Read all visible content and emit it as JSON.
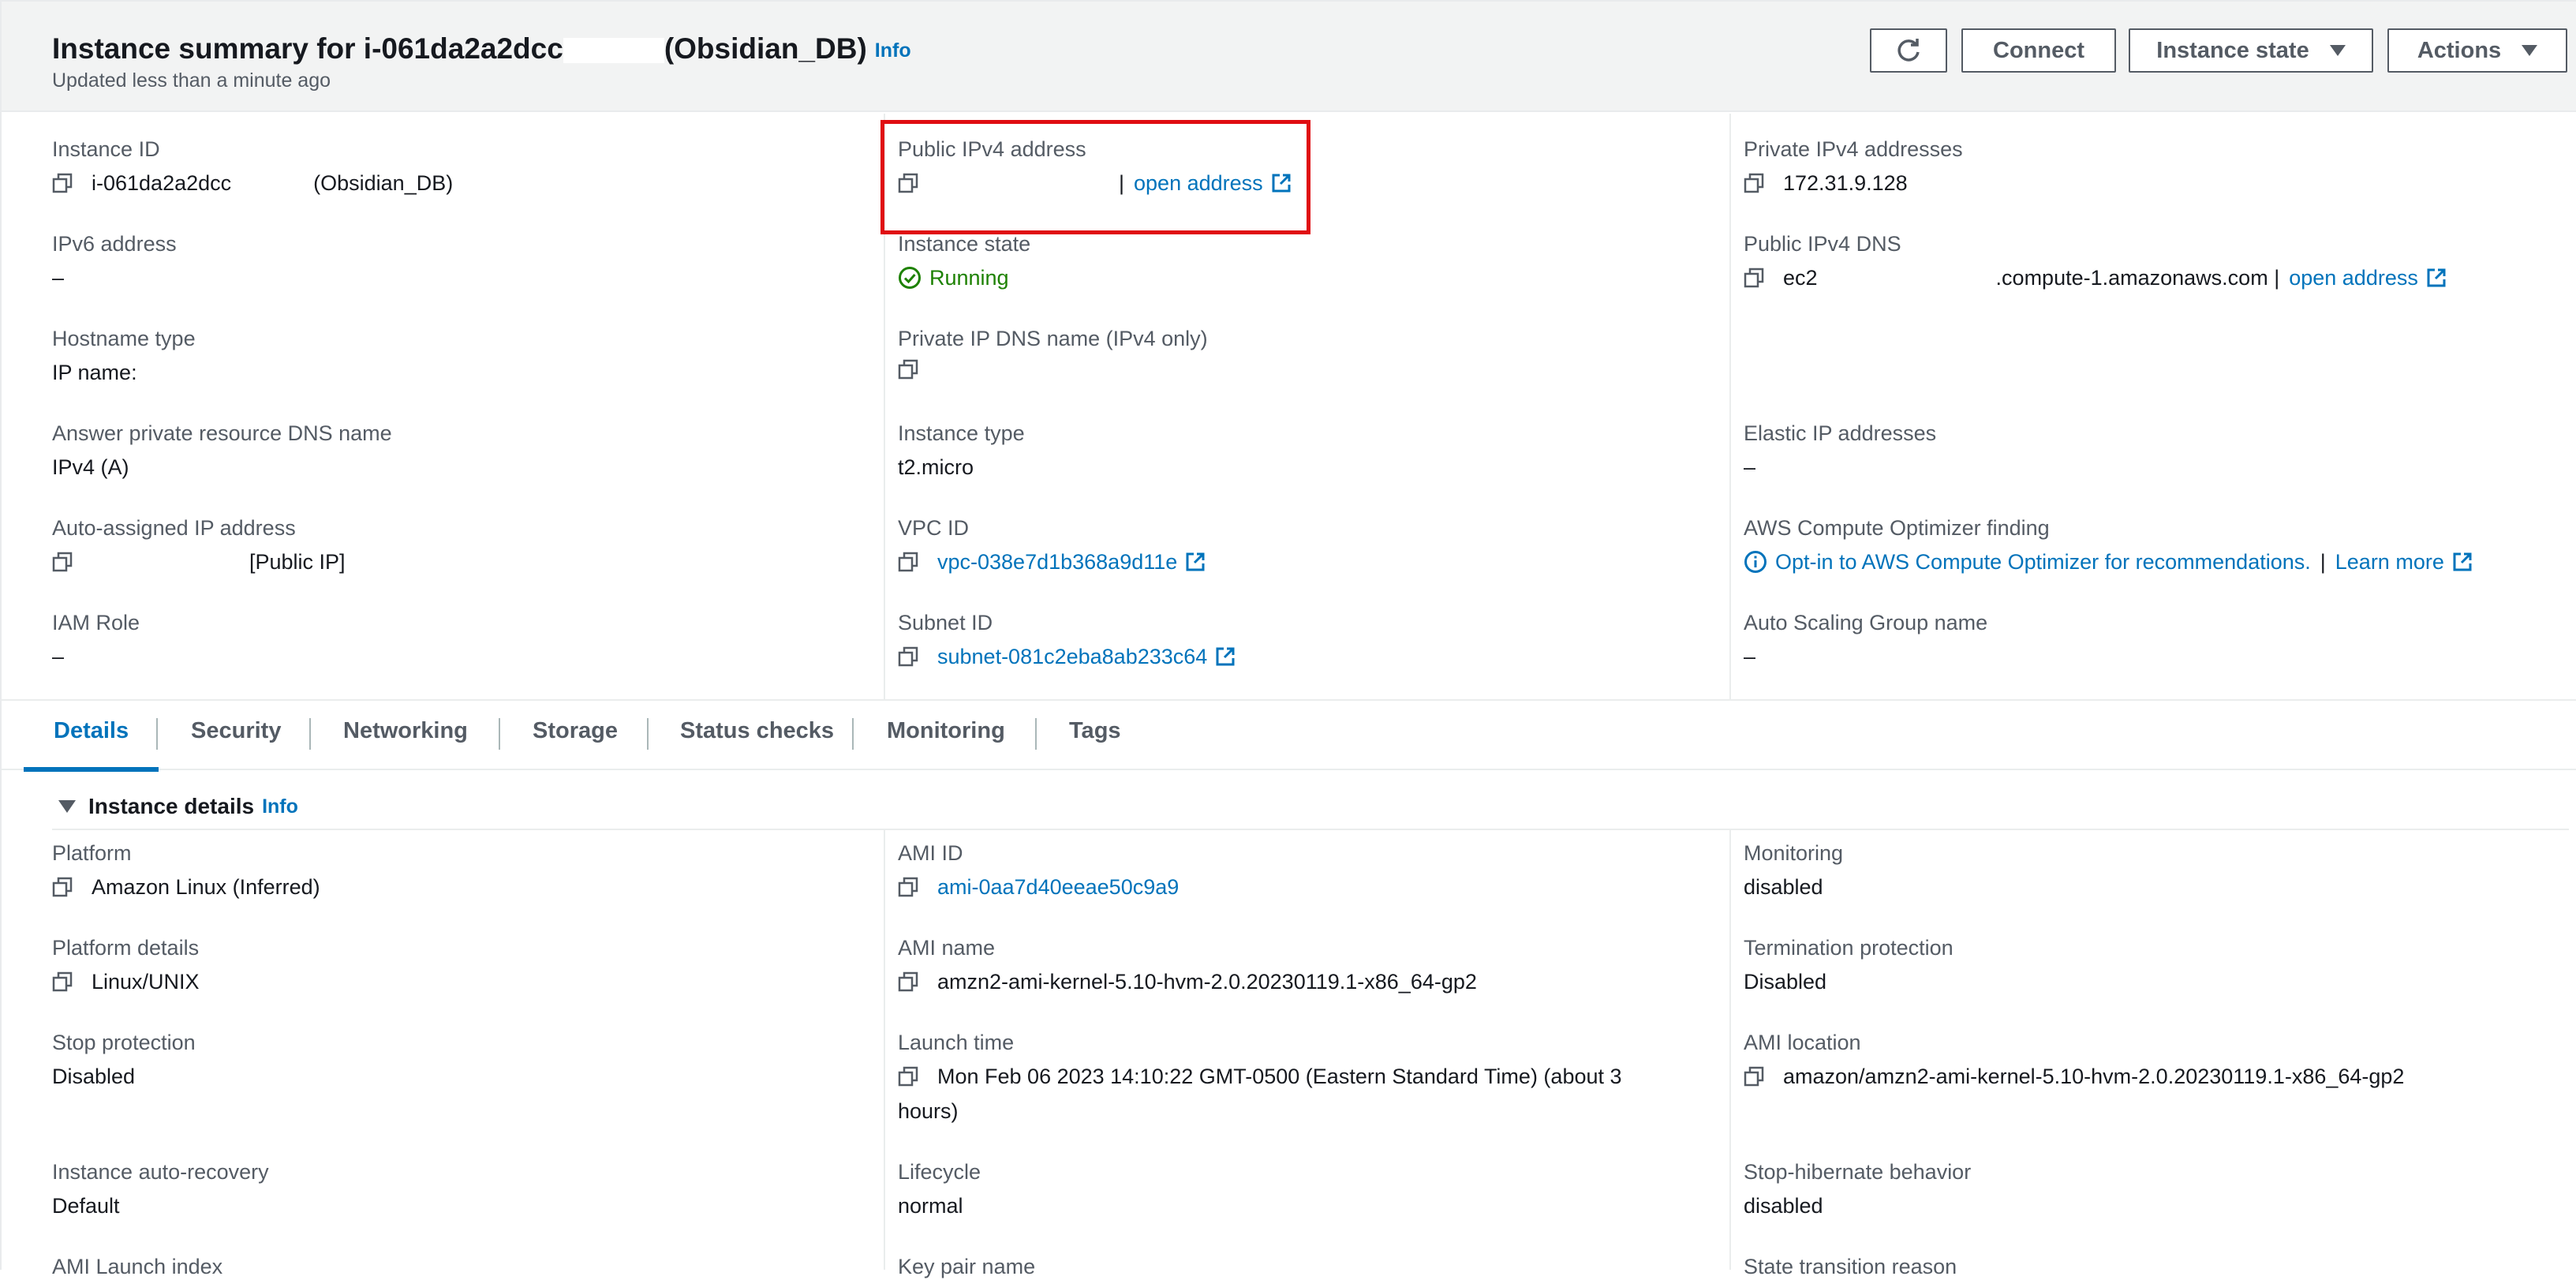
{
  "header": {
    "title_prefix": "Instance summary for i-061da2a2dcс",
    "title_suffix": "(Obsidian_DB)",
    "info": "Info",
    "subtitle": "Updated less than a minute ago",
    "buttons": {
      "connect": "Connect",
      "instance_state": "Instance state",
      "actions": "Actions"
    }
  },
  "summary": {
    "col1": {
      "instance_id_label": "Instance ID",
      "instance_id_value": "i-061da2a2dcс",
      "instance_id_name": "(Obsidian_DB)",
      "ipv6_label": "IPv6 address",
      "ipv6_value": "–",
      "hostname_label": "Hostname type",
      "hostname_value": "IP name:",
      "answer_dns_label": "Answer private resource DNS name",
      "answer_dns_value": "IPv4 (A)",
      "auto_ip_label": "Auto-assigned IP address",
      "auto_ip_value": "[Public IP]",
      "iam_label": "IAM Role",
      "iam_value": "–"
    },
    "col2": {
      "public_ipv4_label": "Public IPv4 address",
      "public_ipv4_sep": "|",
      "public_ipv4_link": "open address",
      "state_label": "Instance state",
      "state_value": "Running",
      "private_dns_label": "Private IP DNS name (IPv4 only)",
      "type_label": "Instance type",
      "type_value": "t2.micro",
      "vpc_label": "VPC ID",
      "vpc_value": "vpc-038e7d1b368a9d11e",
      "subnet_label": "Subnet ID",
      "subnet_value": "subnet-081c2eba8ab233c64"
    },
    "col3": {
      "private_ipv4_label": "Private IPv4 addresses",
      "private_ipv4_value": "172.31.9.128",
      "public_dns_label": "Public IPv4 DNS",
      "public_dns_prefix": "ec2",
      "public_dns_suffix": ".compute-1.amazonaws.com |",
      "public_dns_link": "open address",
      "elastic_label": "Elastic IP addresses",
      "elastic_value": "–",
      "optimizer_label": "AWS Compute Optimizer finding",
      "optimizer_link": "Opt-in to AWS Compute Optimizer for recommendations.",
      "optimizer_sep": "|",
      "optimizer_learn": "Learn more",
      "asg_label": "Auto Scaling Group name",
      "asg_value": "–"
    }
  },
  "tabs": [
    "Details",
    "Security",
    "Networking",
    "Storage",
    "Status checks",
    "Monitoring",
    "Tags"
  ],
  "details": {
    "section_title": "Instance details",
    "info": "Info",
    "col1": {
      "platform_label": "Platform",
      "platform_value": "Amazon Linux (Inferred)",
      "platform_details_label": "Platform details",
      "platform_details_value": "Linux/UNIX",
      "stop_protection_label": "Stop protection",
      "stop_protection_value": "Disabled",
      "auto_recovery_label": "Instance auto-recovery",
      "auto_recovery_value": "Default",
      "launch_index_label": "AMI Launch index"
    },
    "col2": {
      "ami_id_label": "AMI ID",
      "ami_id_value": "ami-0aa7d40eeae50c9a9",
      "ami_name_label": "AMI name",
      "ami_name_value": "amzn2-ami-kernel-5.10-hvm-2.0.20230119.1-x86_64-gp2",
      "launch_time_label": "Launch time",
      "launch_time_value_1": "Mon Feb 06 2023 14:10:22 GMT-0500 (Eastern Standard Time) (about 3",
      "launch_time_value_2": "hours)",
      "lifecycle_label": "Lifecycle",
      "lifecycle_value": "normal",
      "key_pair_label": "Key pair name"
    },
    "col3": {
      "monitoring_label": "Monitoring",
      "monitoring_value": "disabled",
      "termination_label": "Termination protection",
      "termination_value": "Disabled",
      "ami_location_label": "AMI location",
      "ami_location_value": "amazon/amzn2-ami-kernel-5.10-hvm-2.0.20230119.1-x86_64-gp2",
      "hibernate_label": "Stop-hibernate behavior",
      "hibernate_value": "disabled",
      "transition_label": "State transition reason"
    }
  },
  "colors": {
    "link": "#0073bb",
    "running": "#1d8102",
    "highlight": "#e00d12",
    "header_bg": "#f2f3f3"
  }
}
